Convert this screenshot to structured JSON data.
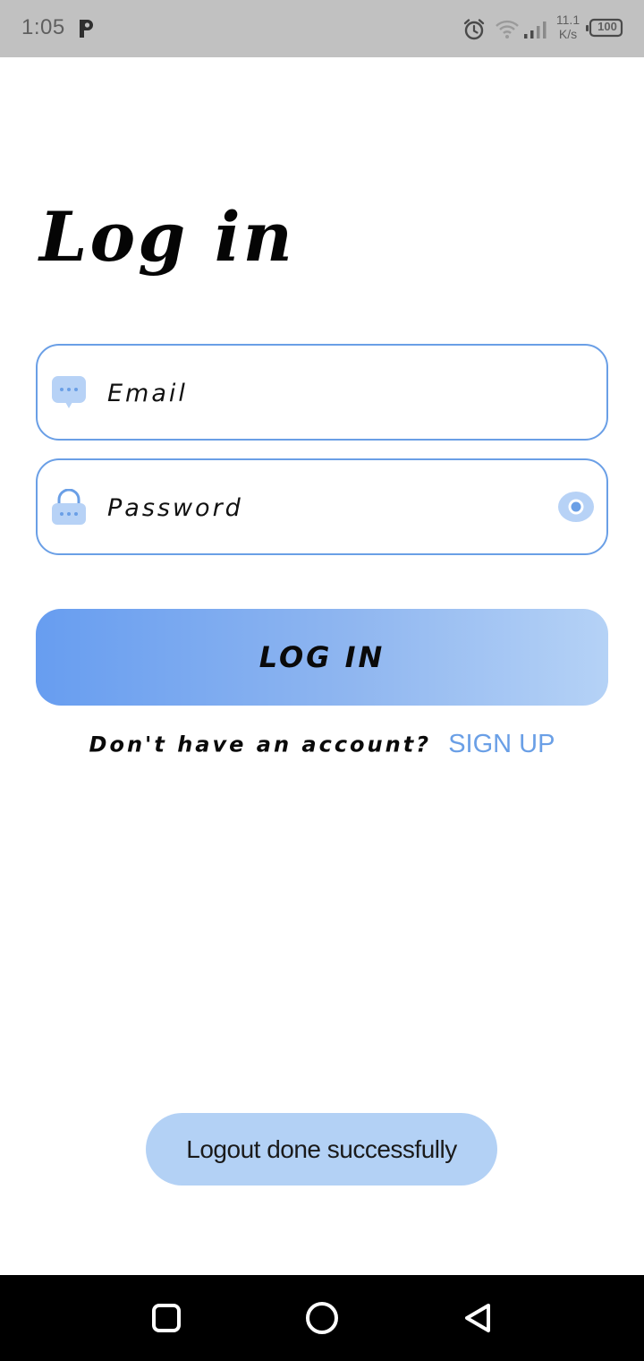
{
  "status_bar": {
    "time": "1:05",
    "net_speed_value": "11.1",
    "net_speed_unit": "K/s",
    "battery": "100",
    "icons": [
      "p-icon",
      "alarm-icon",
      "wifi-icon",
      "signal-icon",
      "battery-icon"
    ]
  },
  "login": {
    "title": "Log in",
    "email_placeholder": "Email",
    "email_value": "",
    "password_placeholder": "Password",
    "password_value": "",
    "button_label": "LOG IN",
    "signup_prompt": "Don't have an account?",
    "signup_link": "SIGN UP"
  },
  "toast": {
    "message": "Logout done successfully"
  },
  "colors": {
    "accent": "#6a9fe6",
    "toast_bg": "#b3d1f5",
    "button_gradient_start": "#679df0",
    "button_gradient_end": "#b5d2f6"
  }
}
